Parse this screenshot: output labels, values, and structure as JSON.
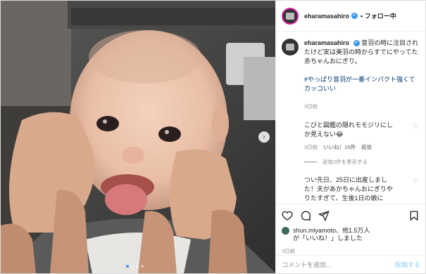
{
  "header": {
    "username": "eharamasahiro",
    "verified_mark": "✔",
    "separator": "•",
    "follow_status": "フォロー中",
    "more_label": "···"
  },
  "caption": {
    "username": "eharamasahiro",
    "text": "音羽の時に注目されたけど実は美羽の時からすでにやってた赤ちゃんおにぎり。",
    "hashtag": "#やっぱり音羽が一番インパクト強くてカッコいい",
    "time": "3日前"
  },
  "comments": [
    {
      "text": "こびと図鑑の隠れモモジリにしか見えない😂",
      "time": "3日前",
      "likes": "いいね！15件",
      "reply": "返信",
      "view_replies": "返信2件を表示する"
    },
    {
      "text": "つい先日、25日に出産しました！夫があかちゃんおにぎりやりたすぎて、生後1日の娘に"
    }
  ],
  "likes": {
    "line1": "shun.miyamoto、他1.5万人",
    "line2": "が「いいね！」しました"
  },
  "post_date": "3日前",
  "add_comment": {
    "placeholder": "コメントを追加...",
    "post_label": "投稿する"
  },
  "media": {
    "next_label": "›",
    "dot_count": 4,
    "active_dot": 0
  },
  "icons": [
    "heart-icon",
    "comment-icon",
    "share-icon",
    "bookmark-icon",
    "chevron-right-icon"
  ],
  "colors": {
    "accent": "#3797f0",
    "link": "#00376b",
    "muted": "#8e8e8e",
    "post_disabled": "#b2dffc"
  }
}
